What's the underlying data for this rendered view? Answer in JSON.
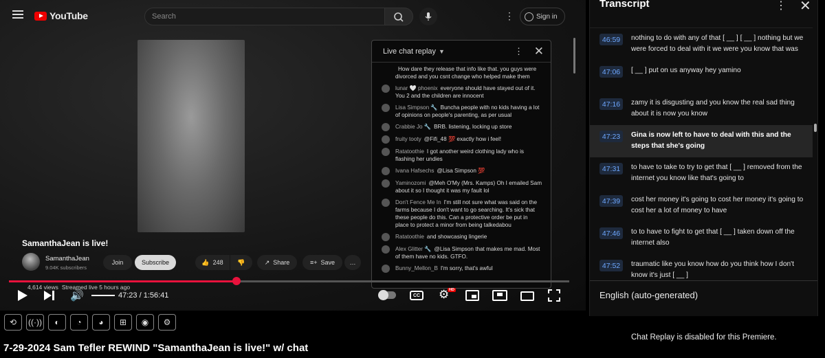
{
  "header": {
    "logo_text": "YouTube",
    "search_placeholder": "Search",
    "signin_label": "Sign in"
  },
  "chat": {
    "title": "Live chat replay",
    "messages": [
      {
        "author": "",
        "text": "How dare they release that info like that. you guys were divorced and you csnt change who helped make them"
      },
      {
        "author": "lunar 🤍 phoenix",
        "text": "everyone should have stayed out of it. You 2 and the children are innocent"
      },
      {
        "author": "Lisa Simpson 🔧",
        "text": "Buncha people with no kids having a lot of opinions on people's parenting, as per usual"
      },
      {
        "author": "Crabbie Jo 🔧",
        "text": "BRB. listening, locking up store"
      },
      {
        "author": "fruity tooty",
        "text": "@Fifi_48 💯 exactly how i feel!"
      },
      {
        "author": "Ratatoothie",
        "text": "I got another weird clothing lady who is flashing her undies"
      },
      {
        "author": "Ivana Hafsechs",
        "text": "@Lisa Simpson 💯"
      },
      {
        "author": "Yaminozomi",
        "text": "@Meh O'My (Mrs. Kamps) Oh I emailed Sam about it so I thought it was my fault lol"
      },
      {
        "author": "Don't Fence Me In",
        "text": "I'm still not sure what was said on the farms because I don't want to go searching. It's sick that these people do this. Can a protective order be put in place to protect a minor from being talkedabou"
      },
      {
        "author": "Ratatoothie",
        "text": "and showcasing lingerie"
      },
      {
        "author": "Alex Glitter 🔧",
        "text": "@Lisa Simpson that makes me mad. Most of them have no kids. GTFO."
      },
      {
        "author": "Bunny_Mellon_B",
        "text": "I'm sorry, that's awful"
      }
    ]
  },
  "overlay": {
    "live_title": "SamanthaJean is live!",
    "channel_name": "SamanthaJean",
    "subscribers": "9.04K subscribers",
    "join_label": "Join",
    "subscribe_label": "Subscribe",
    "likes": "248",
    "share_label": "Share",
    "save_label": "Save",
    "views": "4,614 views",
    "streamed": "Streamed live 5 hours ago"
  },
  "player": {
    "time_display": "47:23 / 1:56:41",
    "progress_fraction": 0.406,
    "volume_fraction": 1.0,
    "cc_label": "CC",
    "hd_badge": "HD"
  },
  "page_title": "7-29-2024 Sam Tefler REWIND \"SamanthaJean is live!\" w/ chat",
  "transcript": {
    "title": "Transcript",
    "segments": [
      {
        "time": "46:59",
        "text": "nothing to do with any of that [ __ ] [ __ ] nothing but we were forced to deal with it we were you know that was"
      },
      {
        "time": "47:06",
        "text": "[ __ ] put on us anyway hey yamino"
      },
      {
        "time": "47:16",
        "text": "zamy it is disgusting and you know the real sad thing about it is now you know"
      },
      {
        "time": "47:23",
        "text": "Gina is now left to have to deal with this and the steps that she's going"
      },
      {
        "time": "47:31",
        "text": "to have to take to try to get that [ __ ] removed from the internet you know like that's going to"
      },
      {
        "time": "47:39",
        "text": "cost her money it's going to cost her money it's going to cost her a lot of money to have"
      },
      {
        "time": "47:46",
        "text": "to to have to fight to get that [ __ ] taken down off the internet also"
      },
      {
        "time": "47:52",
        "text": "traumatic like you know how do you think how I don't know it's just [ __ ]"
      }
    ],
    "active_index": 3,
    "language": "English (auto-generated)"
  },
  "replay_note": "Chat Replay is disabled for this Premiere.",
  "colors": {
    "progress": "#e8123c",
    "timestamp_text": "#6ea8ff",
    "active_segment_bg": "#262626"
  }
}
